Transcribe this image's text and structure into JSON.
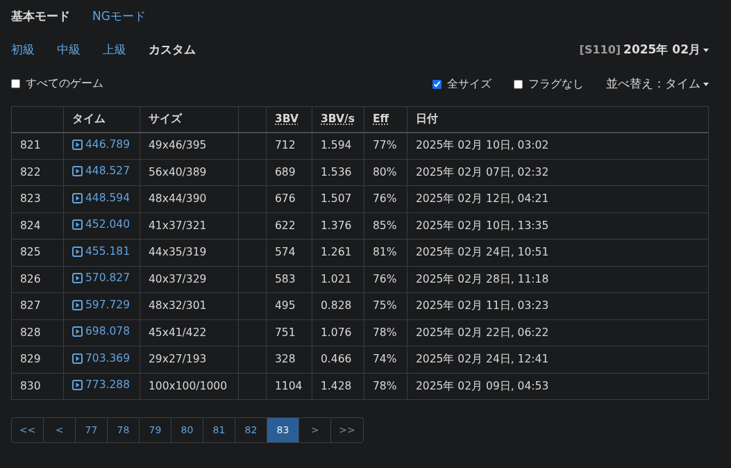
{
  "mode_tabs": [
    {
      "label": "基本モード",
      "selected": true
    },
    {
      "label": "NGモード",
      "selected": false
    }
  ],
  "level_tabs": [
    {
      "label": "初級",
      "selected": false
    },
    {
      "label": "中級",
      "selected": false
    },
    {
      "label": "上級",
      "selected": false
    },
    {
      "label": "カスタム",
      "selected": true
    }
  ],
  "period": {
    "season": "[S110]",
    "month": "2025年 02月"
  },
  "filters": [
    {
      "label": "すべてのゲーム",
      "checked": false
    },
    {
      "label": "全サイズ",
      "checked": true
    },
    {
      "label": "フラグなし",
      "checked": false
    }
  ],
  "sort": {
    "label": "並べ替え：タイム"
  },
  "table": {
    "columns": [
      {},
      {
        "label": "タイム",
        "abbr": false
      },
      {
        "label": "サイズ",
        "abbr": false
      },
      {},
      {
        "label": "3BV",
        "abbr": true
      },
      {
        "label": "3BV/s",
        "abbr": true
      },
      {
        "label": "Eff",
        "abbr": true
      },
      {
        "label": "日付",
        "abbr": false
      }
    ],
    "rows": [
      {
        "rank": "821",
        "time": "446.789",
        "size": "49x46/395",
        "bv": "712",
        "bvs": "1.594",
        "eff": "77%",
        "date": "2025年 02月 10日, 03:02"
      },
      {
        "rank": "822",
        "time": "448.527",
        "size": "56x40/389",
        "bv": "689",
        "bvs": "1.536",
        "eff": "80%",
        "date": "2025年 02月 07日, 02:32"
      },
      {
        "rank": "823",
        "time": "448.594",
        "size": "48x44/390",
        "bv": "676",
        "bvs": "1.507",
        "eff": "76%",
        "date": "2025年 02月 12日, 04:21"
      },
      {
        "rank": "824",
        "time": "452.040",
        "size": "41x37/321",
        "bv": "622",
        "bvs": "1.376",
        "eff": "85%",
        "date": "2025年 02月 10日, 13:35"
      },
      {
        "rank": "825",
        "time": "455.181",
        "size": "44x35/319",
        "bv": "574",
        "bvs": "1.261",
        "eff": "81%",
        "date": "2025年 02月 24日, 10:51"
      },
      {
        "rank": "826",
        "time": "570.827",
        "size": "40x37/329",
        "bv": "583",
        "bvs": "1.021",
        "eff": "76%",
        "date": "2025年 02月 28日, 11:18"
      },
      {
        "rank": "827",
        "time": "597.729",
        "size": "48x32/301",
        "bv": "495",
        "bvs": "0.828",
        "eff": "75%",
        "date": "2025年 02月 11日, 03:23"
      },
      {
        "rank": "828",
        "time": "698.078",
        "size": "45x41/422",
        "bv": "751",
        "bvs": "1.076",
        "eff": "78%",
        "date": "2025年 02月 22日, 06:22"
      },
      {
        "rank": "829",
        "time": "703.369",
        "size": "29x27/193",
        "bv": "328",
        "bvs": "0.466",
        "eff": "74%",
        "date": "2025年 02月 24日, 12:41"
      },
      {
        "rank": "830",
        "time": "773.288",
        "size": "100x100/1000",
        "bv": "1104",
        "bvs": "1.428",
        "eff": "78%",
        "date": "2025年 02月 09日, 04:53"
      }
    ]
  },
  "pagination": [
    {
      "label": "<<",
      "selected": false,
      "disabled": false
    },
    {
      "label": "<",
      "selected": false,
      "disabled": false
    },
    {
      "label": "77",
      "selected": false,
      "disabled": false
    },
    {
      "label": "78",
      "selected": false,
      "disabled": false
    },
    {
      "label": "79",
      "selected": false,
      "disabled": false
    },
    {
      "label": "80",
      "selected": false,
      "disabled": false
    },
    {
      "label": "81",
      "selected": false,
      "disabled": false
    },
    {
      "label": "82",
      "selected": false,
      "disabled": false
    },
    {
      "label": "83",
      "selected": true,
      "disabled": false
    },
    {
      "label": ">",
      "selected": false,
      "disabled": true
    },
    {
      "label": ">>",
      "selected": false,
      "disabled": true
    }
  ]
}
